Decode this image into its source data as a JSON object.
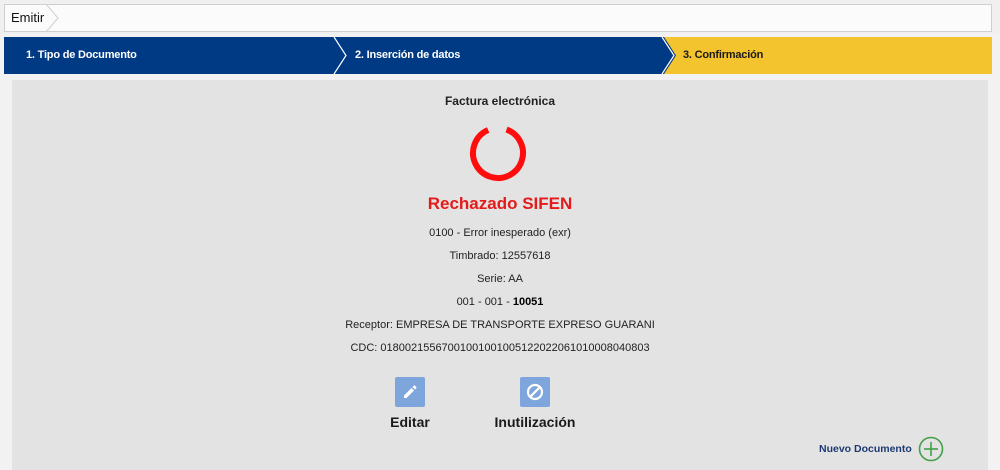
{
  "breadcrumb": {
    "label": "Emitir"
  },
  "steps": [
    {
      "label": "1. Tipo de Documento",
      "bg": "#003a85"
    },
    {
      "label": "2. Inserción de datos",
      "bg": "#003a85"
    },
    {
      "label": "3. Confirmación",
      "bg": "#f3c42e"
    }
  ],
  "document": {
    "title": "Factura electrónica",
    "status": "Rechazado SIFEN",
    "status_color": "#e31b1b",
    "error": "0100 - Error inesperado (exr)",
    "timbrado": "Timbrado: 12557618",
    "serie": "Serie: AA",
    "number_prefix": "001 - 001 -",
    "number": "10051",
    "receptor": "Receptor: EMPRESA DE TRANSPORTE EXPRESO GUARANI",
    "cdc": "CDC: 01800215567001001001005122022061010008040803"
  },
  "actions": {
    "edit_label": "Editar",
    "edit_icon": "pencil-icon",
    "inutil_label": "Inutilización",
    "inutil_icon": "ban-icon"
  },
  "new_document": {
    "label": "Nuevo Documento",
    "icon": "plus-circle-icon",
    "icon_color": "#43a047"
  }
}
